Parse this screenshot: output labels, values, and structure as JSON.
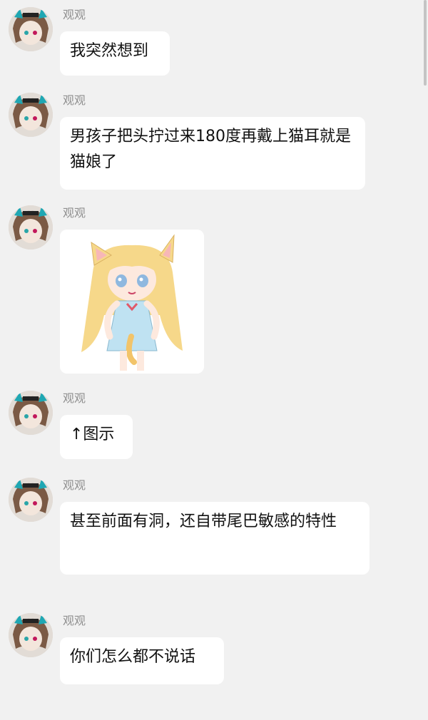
{
  "chat": {
    "messages": [
      {
        "sender": "观观",
        "text": "我突然想到"
      },
      {
        "sender": "观观",
        "text": "男孩子把头拧过来180度再戴上猫耳就是猫娘了"
      },
      {
        "sender": "观观",
        "image": "anime-catgirl-sticker"
      },
      {
        "sender": "观观",
        "text": "↑图示"
      },
      {
        "sender": "观观",
        "text": "甚至前面有洞，还自带尾巴敏感的特性"
      },
      {
        "sender": "观观",
        "text": "你们怎么都不说话"
      }
    ]
  },
  "colors": {
    "background": "#f1f1f1",
    "bubble": "#ffffff",
    "sender_name": "#8f8f8f"
  }
}
